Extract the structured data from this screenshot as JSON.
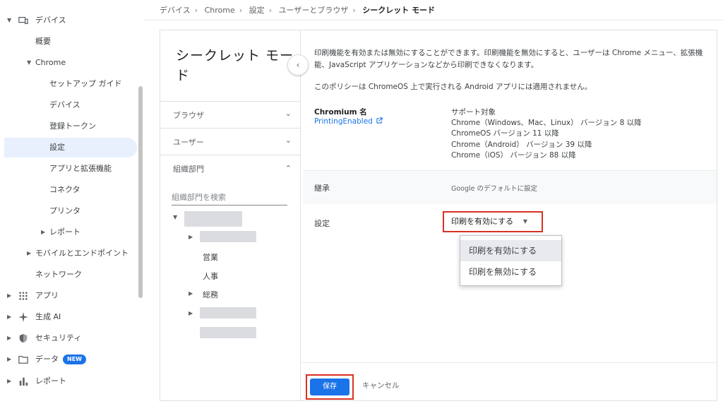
{
  "breadcrumb": [
    "デバイス",
    "Chrome",
    "設定",
    "ユーザーとブラウザ",
    "シークレット モード"
  ],
  "nav": {
    "items": [
      {
        "label": "デバイス",
        "icon": "devices-icon"
      },
      {
        "label": "概要"
      },
      {
        "label": "Chrome"
      },
      {
        "label": "セットアップ ガイド"
      },
      {
        "label": "デバイス"
      },
      {
        "label": "登録トークン"
      },
      {
        "label": "設定"
      },
      {
        "label": "アプリと拡張機能"
      },
      {
        "label": "コネクタ"
      },
      {
        "label": "プリンタ"
      },
      {
        "label": "レポート"
      },
      {
        "label": "モバイルとエンドポイント"
      },
      {
        "label": "ネットワーク"
      },
      {
        "label": "アプリ",
        "icon": "apps-grid-icon"
      },
      {
        "label": "生成 AI",
        "icon": "sparkle-icon"
      },
      {
        "label": "セキュリティ",
        "icon": "shield-icon"
      },
      {
        "label": "データ",
        "icon": "folder-icon",
        "badge": "NEW"
      },
      {
        "label": "レポート",
        "icon": "bar-chart-icon"
      }
    ]
  },
  "panel": {
    "title": "シークレット モード",
    "sections": [
      "ブラウザ",
      "ユーザー",
      "組織部門"
    ],
    "search_placeholder": "組織部門を検索",
    "tree": [
      "営業",
      "人事",
      "総務"
    ]
  },
  "policy": {
    "description1": "印刷機能を有効または無効にすることができます。印刷機能を無効にすると、ユーザーは Chrome メニュー、拡張機能、JavaScript アプリケーションなどから印刷できなくなります。",
    "description2": "このポリシーは ChromeOS 上で実行される Android アプリには適用されません。",
    "chromium_name_label": "Chromium 名",
    "chromium_name_value": "PrintingEnabled",
    "support_label": "サポート対象",
    "support_lines": [
      "Chrome（Windows、Mac、Linux） バージョン 8 以降",
      "ChromeOS バージョン 11 以降",
      "Chrome（Android） バージョン 39 以降",
      "Chrome（iOS） バージョン 88 以降"
    ],
    "inherit_label": "継承",
    "inherit_value": "Google のデフォルトに設定",
    "setting_label": "設定",
    "selected_value": "印刷を有効にする",
    "options": [
      "印刷を有効にする",
      "印刷を無効にする"
    ]
  },
  "footer": {
    "save": "保存",
    "cancel": "キャンセル"
  },
  "colors": {
    "accent": "#1a73e8",
    "highlight": "#d93025",
    "active_nav": "#e8f0fe"
  }
}
